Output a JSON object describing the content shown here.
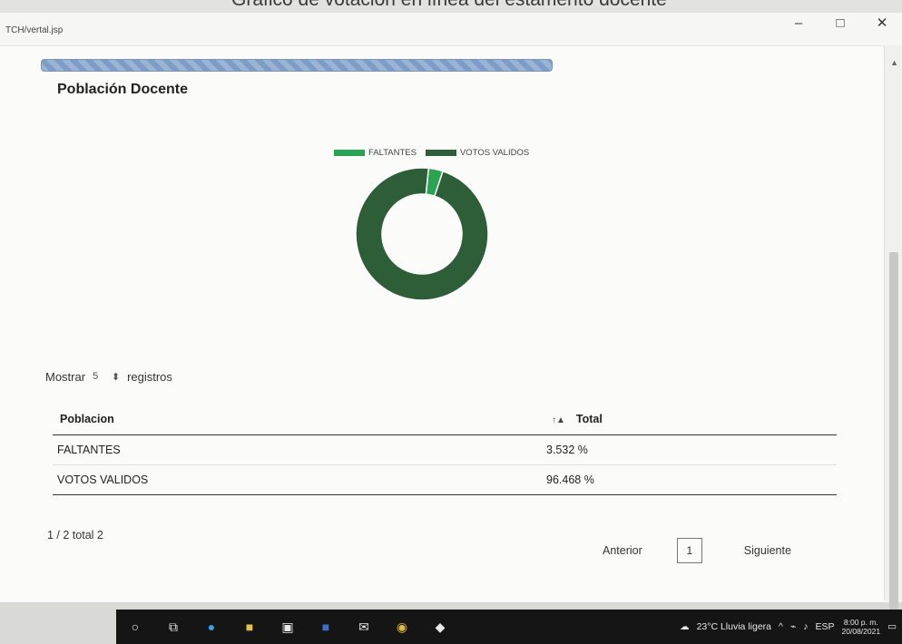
{
  "caption": {
    "text": "Gráfico de votación en línea del estamento docente"
  },
  "window": {
    "address": "TCH/vertal.jsp",
    "minimize": "–",
    "maximize": "□",
    "close": "✕"
  },
  "page": {
    "title": "Población Docente"
  },
  "chart_data": {
    "type": "pie",
    "title": "",
    "categories": [
      "FALTANTES",
      "VOTOS VALIDOS"
    ],
    "values": [
      3.532,
      96.468
    ],
    "colors": [
      "#2aa353",
      "#2e5e38"
    ],
    "legend": "top",
    "donut": true
  },
  "entries": {
    "prefix": "Mostrar",
    "value": "5",
    "suffix": "registros"
  },
  "table": {
    "headers": [
      "Poblacion",
      "Total"
    ],
    "rows": [
      [
        "FALTANTES",
        "3.532 %"
      ],
      [
        "VOTOS VALIDOS",
        "96.468 %"
      ]
    ]
  },
  "info": "1 / 2 total 2",
  "pager": {
    "prev": "Anterior",
    "page": "1",
    "next": "Siguiente"
  },
  "taskbar": {
    "weather": "23°C  Lluvia ligera",
    "lang": "ESP",
    "time": "8:00 p. m.",
    "date": "20/08/2021"
  }
}
